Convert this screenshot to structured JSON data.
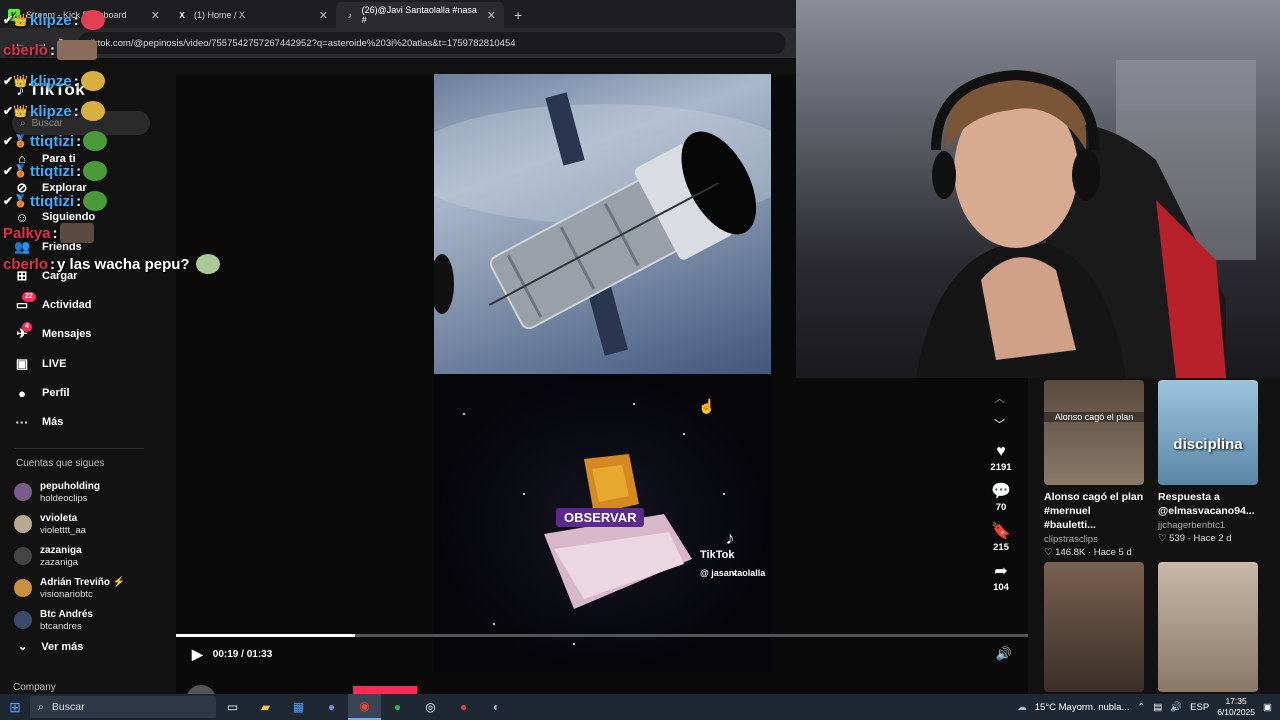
{
  "browser": {
    "tabs": [
      {
        "label": "Stream - Kick Dashboard",
        "icon": "K",
        "icon_color": "#53fc18"
      },
      {
        "label": "(1) Home / X",
        "icon": "X",
        "icon_color": "#ffffff"
      },
      {
        "label": "(26)@Javi Santaolalla #nasa #",
        "icon": "♪",
        "icon_color": "#ffffff"
      }
    ],
    "new_tab": "+",
    "url": "tiktok.com/@pepinosis/video/7557542757267442952?q=asteroide%203i%20atlas&t=1759782810454"
  },
  "tiktok": {
    "logo": "TikTok",
    "search_placeholder": "Buscar",
    "menu": [
      {
        "label": "Para ti",
        "icon": "⌂"
      },
      {
        "label": "Explorar",
        "icon": "⊘"
      },
      {
        "label": "Siguiendo",
        "icon": "☺"
      },
      {
        "label": "Friends",
        "icon": "👥"
      },
      {
        "label": "Cargar",
        "icon": "⊞"
      },
      {
        "label": "Actividad",
        "icon": "▭",
        "badge": "22"
      },
      {
        "label": "Mensajes",
        "icon": "✈",
        "badge": "4"
      },
      {
        "label": "LIVE",
        "icon": "▣"
      },
      {
        "label": "Perfil",
        "icon": "●"
      },
      {
        "label": "Más",
        "icon": "···"
      }
    ],
    "following_title": "Cuentas que sigues",
    "following": [
      {
        "name": "pepuholding",
        "handle": "holdeoclips",
        "color": "#7a5a8c"
      },
      {
        "name": "vvioleta",
        "handle": "violetttt_aa",
        "color": "#b8a890"
      },
      {
        "name": "zazaniga",
        "handle": "zazaniga",
        "color": "#444"
      },
      {
        "name": "Adrián Treviño ⚡",
        "handle": "visionariobtc",
        "color": "#c89040"
      },
      {
        "name": "Btc Andrés",
        "handle": "btcandres",
        "color": "#3a4a6a"
      }
    ],
    "ver_mas": "Ver más",
    "company": "Company",
    "video": {
      "overlay_text": "OBSERVAR",
      "watermark_brand": "TikTok",
      "watermark_handle": "@ jasantaolalla",
      "time": "00:19 / 01:33",
      "progress_fraction": 0.21
    },
    "author": "pepinosis",
    "actions": [
      {
        "icon": "♥",
        "count": "2191",
        "name": "like"
      },
      {
        "icon": "💬",
        "count": "70",
        "name": "comment"
      },
      {
        "icon": "🔖",
        "count": "215",
        "name": "bookmark"
      },
      {
        "icon": "➦",
        "count": "104",
        "name": "share"
      }
    ],
    "related": [
      {
        "overlay": "Alonso cagó el plan",
        "title": "Alonso cagó el plan #mernuel #bauletti...",
        "user": "clipstrasclips",
        "stats": "♡ 146.8K · Hace 5 d",
        "bg": "#6a5a4a"
      },
      {
        "overlay": "disciplina",
        "title": "Respuesta a @elmasvacano94...",
        "user": "jjchagerbenbtc1",
        "stats": "♡ 539 · Hace 2 d",
        "bg": "#7fa8c8"
      },
      {
        "overlay": "",
        "title": "",
        "user": "",
        "stats": "",
        "bg": "#8a7060"
      },
      {
        "overlay": "",
        "title": "",
        "user": "",
        "stats": "",
        "bg": "#b8a898"
      }
    ]
  },
  "chat": [
    {
      "user": "klipze",
      "user_color": "#3ab0ff",
      "msg": "",
      "badges": "✔👑"
    },
    {
      "user": "cberlo",
      "user_color": "#e0304a",
      "msg": "",
      "badges": ""
    },
    {
      "user": "klipze",
      "user_color": "#3ab0ff",
      "msg": "",
      "badges": "✔👑"
    },
    {
      "user": "klipze",
      "user_color": "#3ab0ff",
      "msg": "",
      "badges": "✔👑"
    },
    {
      "user": "ttiqtizi",
      "user_color": "#3ab0ff",
      "msg": "",
      "badges": "✔🥉"
    },
    {
      "user": "ttiqtizi",
      "user_color": "#3ab0ff",
      "msg": "",
      "badges": "✔🥉"
    },
    {
      "user": "ttiqtizi",
      "user_color": "#3ab0ff",
      "msg": "",
      "badges": "✔🥉"
    },
    {
      "user": "Palkya",
      "user_color": "#e0304a",
      "msg": "",
      "badges": ""
    },
    {
      "user": "cberlo",
      "user_color": "#e0304a",
      "msg": " y las wacha pepu?",
      "badges": ""
    }
  ],
  "taskbar": {
    "search": "Buscar",
    "weather": "15°C  Mayorm. nubla...",
    "lang": "ESP",
    "time": "17:35",
    "date": "6/10/2025"
  }
}
